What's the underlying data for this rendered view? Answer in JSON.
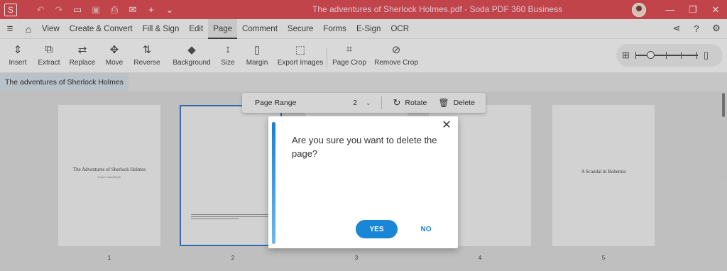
{
  "titlebar": {
    "logo": "S",
    "doc_title": "The adventures of Sherlock Holmes.pdf  -  Soda PDF 360 Business",
    "icons": [
      "undo-icon",
      "redo-icon",
      "open-folder-icon",
      "save-icon",
      "print-icon",
      "mail-icon",
      "plus-icon",
      "chevron-down-icon"
    ]
  },
  "menu": {
    "items": [
      "View",
      "Create & Convert",
      "Fill & Sign",
      "Edit",
      "Page",
      "Comment",
      "Secure",
      "Forms",
      "E-Sign",
      "OCR"
    ],
    "active": "Page"
  },
  "ribbon": {
    "items": [
      {
        "label": "Insert",
        "icon": "insert-icon",
        "glyph": "⇕"
      },
      {
        "label": "Extract",
        "icon": "extract-icon",
        "glyph": "⧉"
      },
      {
        "label": "Replace",
        "icon": "replace-icon",
        "glyph": "⇄"
      },
      {
        "label": "Move",
        "icon": "move-icon",
        "glyph": "✥"
      },
      {
        "label": "Reverse",
        "icon": "reverse-icon",
        "glyph": "⇅"
      },
      {
        "label": "Background",
        "icon": "background-icon",
        "glyph": "◆"
      },
      {
        "label": "Size",
        "icon": "size-icon",
        "glyph": "↕"
      },
      {
        "label": "Margin",
        "icon": "margin-icon",
        "glyph": "▯"
      },
      {
        "label": "Export Images",
        "icon": "export-images-icon",
        "glyph": "⬚"
      },
      {
        "label": "Page Crop",
        "icon": "page-crop-icon",
        "glyph": "⌗"
      },
      {
        "label": "Remove Crop",
        "icon": "remove-crop-icon",
        "glyph": "⊘"
      }
    ]
  },
  "doc_tab": "The adventures of Sherlock Holmes",
  "pages": [
    {
      "number": "1",
      "title": "The Adventures of Sherlock Holmes",
      "subtitle": "Arthur Conan Doyle"
    },
    {
      "number": "2",
      "title": "",
      "subtitle": ""
    },
    {
      "number": "3",
      "title": "",
      "subtitle": ""
    },
    {
      "number": "4",
      "title": "",
      "subtitle": ""
    },
    {
      "number": "5",
      "title": "A Scandal in Bohemia",
      "subtitle": ""
    }
  ],
  "page_range": {
    "label": "Page Range",
    "value": "2",
    "rotate_label": "Rotate",
    "delete_label": "Delete"
  },
  "dialog": {
    "message": "Are you sure you want to delete the page?",
    "yes_label": "YES",
    "no_label": "NO"
  },
  "colors": {
    "titlebar": "#d84047",
    "accent": "#1a86d6",
    "selection": "#2d6fbf"
  }
}
